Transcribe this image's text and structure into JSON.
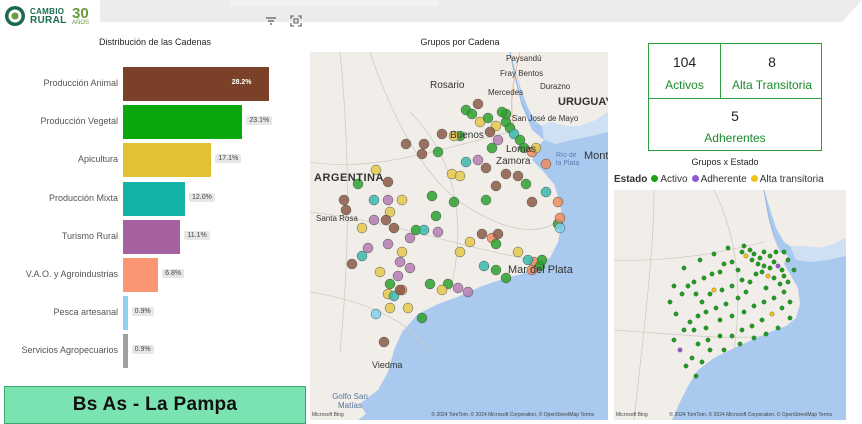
{
  "header": {
    "logo_line1": "CAMBIO",
    "logo_line2": "RURAL",
    "logo_30": "30",
    "logo_anos": "AÑOS"
  },
  "colors": {
    "accent": "#1a8a2e",
    "activo": "#1aa11a",
    "adherente": "#8e5ad8",
    "alta_transitoria": "#f0c419",
    "region_button": "#7be3b1"
  },
  "icons": [
    "filter-icon",
    "focus-mode-icon"
  ],
  "bar_panel": {
    "title": "Distribución de las Cadenas"
  },
  "chart_data": {
    "type": "bar",
    "orientation": "horizontal",
    "title": "Distribución de las Cadenas",
    "categories": [
      "Producción Animal",
      "Producción Vegetal",
      "Apicultura",
      "Producción Mixta",
      "Turismo Rural",
      "V.A.O. y Agroindustrias",
      "Pesca artesanal",
      "Servicios Agropecuarios"
    ],
    "values": [
      28.2,
      23.1,
      17.1,
      12.0,
      11.1,
      6.8,
      0.9,
      0.9
    ],
    "value_labels": [
      "28.2%",
      "23.1%",
      "17.1%",
      "12.0%",
      "11.1%",
      "6.8%",
      "0.9%",
      "0.9%"
    ],
    "colors": [
      "#7a4028",
      "#0aa80a",
      "#e2c234",
      "#13b3a8",
      "#a662a0",
      "#fa9672",
      "#8fd3ef",
      "#a0a0a0"
    ],
    "xlim": [
      0,
      30
    ]
  },
  "map1": {
    "title": "Grupos por Cadena",
    "labels": [
      "Paysandú",
      "Fray Bentos",
      "Rosario",
      "Mercedes",
      "Durazno",
      "URUGUAY",
      "San José de Mayo",
      "Buenos",
      "Lomas",
      "Zamora",
      "Montevideo",
      "Río de la Plata",
      "ARGENTINA",
      "Santa Rosa",
      "Mar del Plata",
      "Viedma",
      "Golfo San Matías"
    ],
    "attribution": "© 2024 TomTom, © 2024 Microsoft Corporation, © OpenStreetMap  Terms",
    "bing": "Microsoft Bing"
  },
  "kpis": [
    {
      "value": "104",
      "label": "Activos"
    },
    {
      "value": "8",
      "label": "Alta Transitoria"
    },
    {
      "value": "5",
      "label": "Adherentes"
    }
  ],
  "map2": {
    "title": "Grupos x Estado",
    "legend_title": "Estado",
    "legend_items": [
      "Activo",
      "Adherente",
      "Alta transitoria"
    ],
    "attribution": "© 2024 TomTom, © 2024 Microsoft Corporation, © OpenStreetMap  Terms",
    "bing": "Microsoft Bing"
  },
  "region_button": "Bs As - La Pampa"
}
